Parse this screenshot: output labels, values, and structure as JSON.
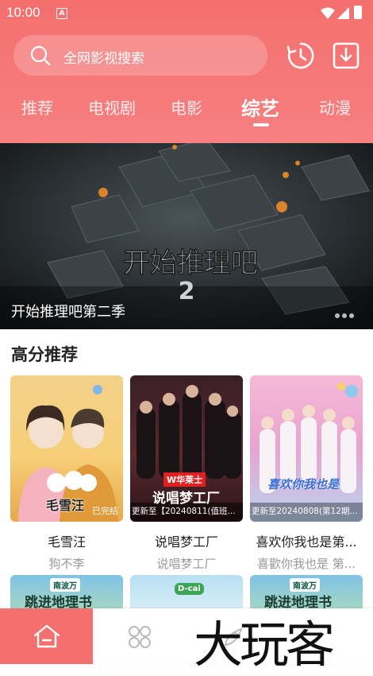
{
  "status": {
    "time": "10:00",
    "notification_icon": "A"
  },
  "search": {
    "placeholder": "全网影视搜索"
  },
  "tabs": [
    {
      "label": "推荐"
    },
    {
      "label": "电视剧"
    },
    {
      "label": "电影"
    },
    {
      "label": "综艺",
      "active": true
    },
    {
      "label": "动漫"
    }
  ],
  "banner": {
    "title": "开始推理吧第二季",
    "logo_text": "开始推理吧",
    "logo_number": "2",
    "dots": 3
  },
  "section": {
    "title": "高分推荐"
  },
  "cards": [
    {
      "name": "毛雪汪",
      "sub": "狗不李",
      "badge": "已完结",
      "poster_text": "毛雪汪"
    },
    {
      "name": "说唱梦工厂",
      "sub": "说唱梦工厂",
      "badge": "更新至【20240811(值班...",
      "poster_text": "说唱梦工厂",
      "brand": "W华莱士"
    },
    {
      "name": "喜欢你我也是第...",
      "sub": "喜歡你我也是 第...",
      "badge": "更新至20240808(第12期...",
      "poster_text": "喜欢你我也是"
    }
  ],
  "row2": [
    {
      "brand": "南波万",
      "poster_text": "跳进地理书"
    },
    {
      "brand": "D-cai"
    },
    {
      "brand": "南波万",
      "poster_text": "跳进地理书"
    }
  ],
  "watermark": "大玩客",
  "colors": {
    "accent": "#f46f6f",
    "header_gradient_end": "#f78080"
  },
  "nav": {
    "icons": [
      "home-icon",
      "category-icon",
      "rocket-icon"
    ]
  }
}
